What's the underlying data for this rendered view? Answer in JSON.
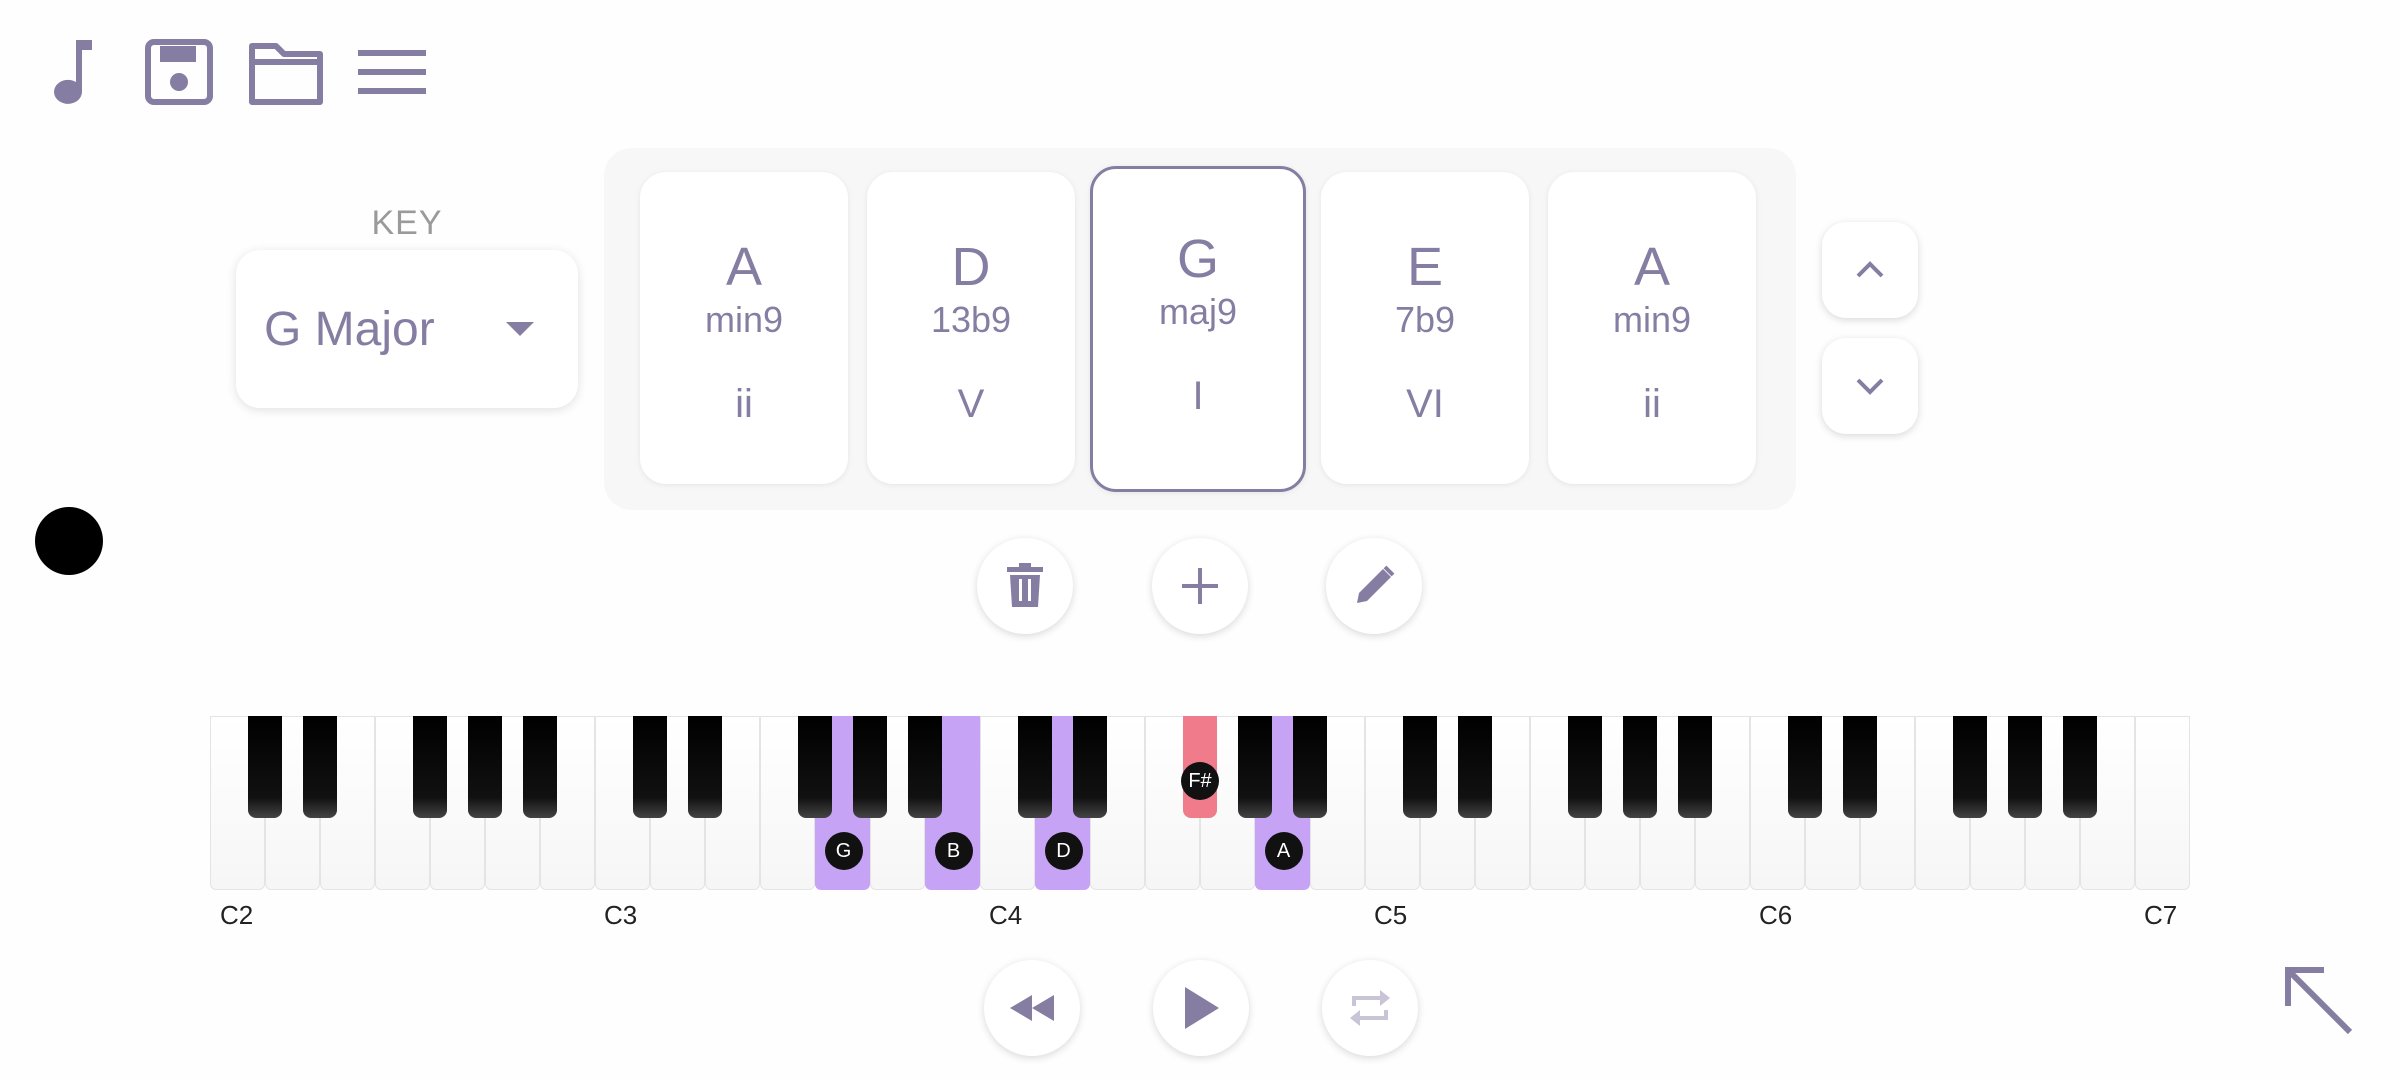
{
  "toolbar": {
    "icons": [
      "music-note-icon",
      "save-icon",
      "folder-icon",
      "menu-icon"
    ]
  },
  "key": {
    "label": "KEY",
    "value": "G Major"
  },
  "chords": [
    {
      "root": "A",
      "quality": "min9",
      "roman": "ii"
    },
    {
      "root": "D",
      "quality": "13b9",
      "roman": "V"
    },
    {
      "root": "G",
      "quality": "maj9",
      "roman": "I",
      "active": true
    },
    {
      "root": "E",
      "quality": "7b9",
      "roman": "VI"
    },
    {
      "root": "A",
      "quality": "min9",
      "roman": "ii"
    }
  ],
  "piano": {
    "octave_labels": [
      "C2",
      "C3",
      "C4",
      "C5",
      "C6",
      "C7"
    ],
    "highlighted_notes": [
      {
        "note": "G",
        "color": "#c6a3f5"
      },
      {
        "note": "B",
        "color": "#c6a3f5"
      },
      {
        "note": "D",
        "color": "#c6a3f5"
      },
      {
        "note": "F#",
        "color": "#f07b8a"
      },
      {
        "note": "A",
        "color": "#c6a3f5"
      }
    ]
  },
  "colors": {
    "accent": "#857ea2",
    "highlight": "#c6a3f5",
    "sharp_highlight": "#f07b8a"
  }
}
